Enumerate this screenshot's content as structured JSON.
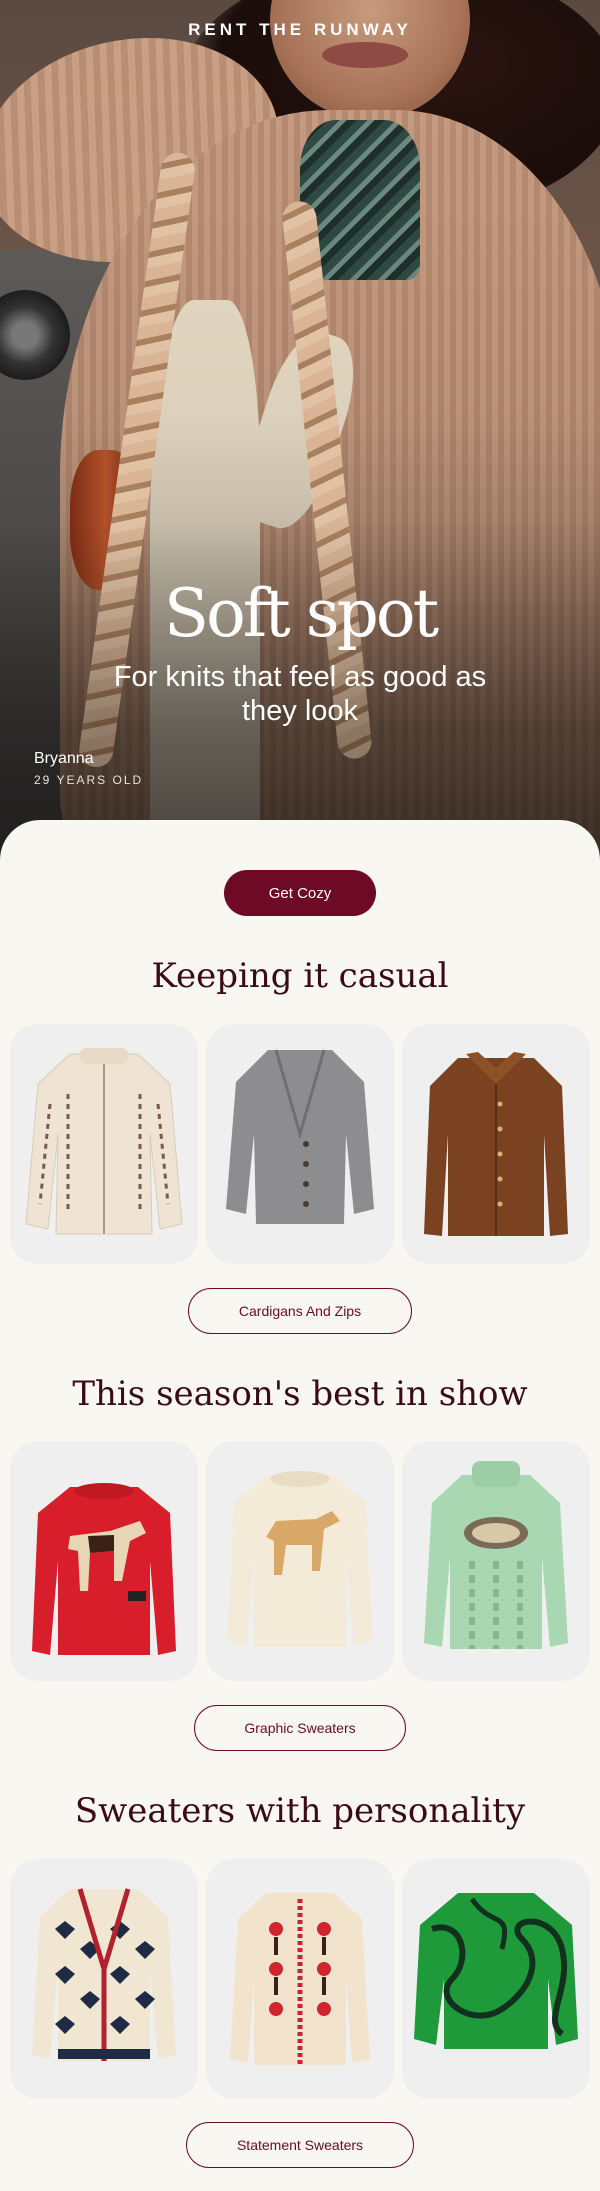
{
  "brand": "RENT THE RUNWAY",
  "hero": {
    "title": "Soft spot",
    "subtitle": "For knits that feel as good as they look",
    "model_name": "Bryanna",
    "model_age": "29 YEARS OLD"
  },
  "primary_cta": "Get Cozy",
  "sections": [
    {
      "title": "Keeping it casual",
      "button": "Cardigans And Zips",
      "products": [
        {
          "name": "cream-zip-sweater-image",
          "color": "#efe3d3"
        },
        {
          "name": "grey-cardigan-image",
          "color": "#8d8d8f"
        },
        {
          "name": "brown-cardigan-image",
          "color": "#7a4220"
        }
      ]
    },
    {
      "title": "This season's best in show",
      "button": "Graphic Sweaters",
      "products": [
        {
          "name": "red-dog-sweater-image",
          "color": "#d81e2a"
        },
        {
          "name": "cream-dog-sweater-image",
          "color": "#f3ead8"
        },
        {
          "name": "mint-cable-sweater-image",
          "color": "#a8d7b1"
        }
      ]
    },
    {
      "title": "Sweaters with personality",
      "button": "Statement Sweaters",
      "products": [
        {
          "name": "heart-print-cardigan-image",
          "color": "#1f2a44"
        },
        {
          "name": "floral-cardigan-image",
          "color": "#f1e3cc"
        },
        {
          "name": "green-swirl-sweater-image",
          "color": "#1f9a3b"
        }
      ]
    }
  ],
  "colors": {
    "accent": "#6e0a26",
    "background": "#f8f7f2",
    "card": "#efefef",
    "heading": "#3a0a16"
  }
}
